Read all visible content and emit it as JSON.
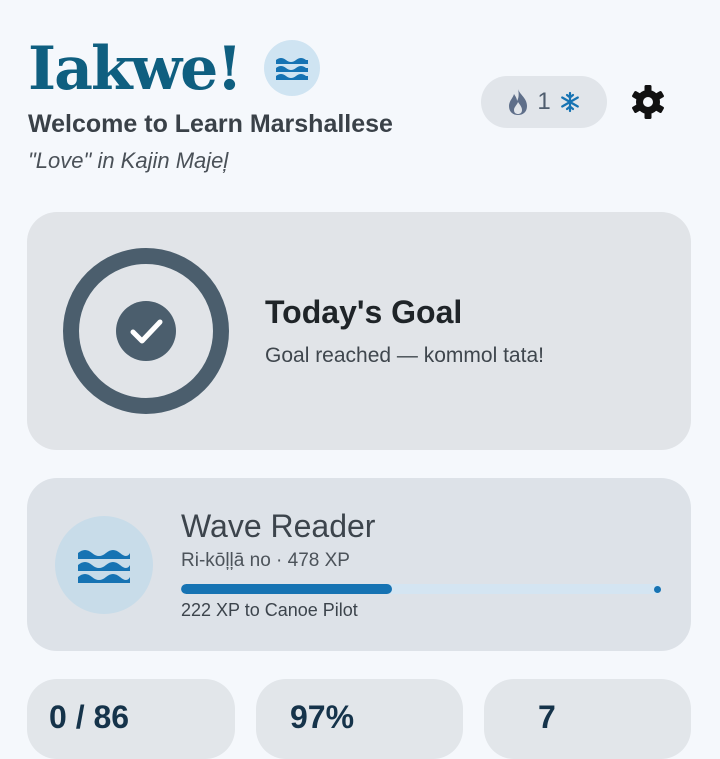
{
  "header": {
    "title": "Iakwe!",
    "welcome": "Welcome to Learn Marshallese",
    "subtitle": "\"Love\" in Kajin Majeļ",
    "streak_count": "1",
    "logo_icon": "waves-icon"
  },
  "goal_card": {
    "title": "Today's Goal",
    "status": "Goal reached — kommol tata!",
    "progress": 1.0,
    "icon": "check-icon"
  },
  "level_card": {
    "name": "Wave Reader",
    "meta": "Ri-kōļļā no · 478 XP",
    "next": "222 XP to Canoe Pilot",
    "progress": 0.44,
    "icon": "waves-icon"
  },
  "stats": [
    {
      "value": "0 / 86"
    },
    {
      "value": "97%"
    },
    {
      "value": "7"
    }
  ],
  "colors": {
    "brand": "#0f5f80",
    "accent": "#1673b3",
    "ring": "#4b5e6d",
    "background": "#f5f8fc"
  }
}
